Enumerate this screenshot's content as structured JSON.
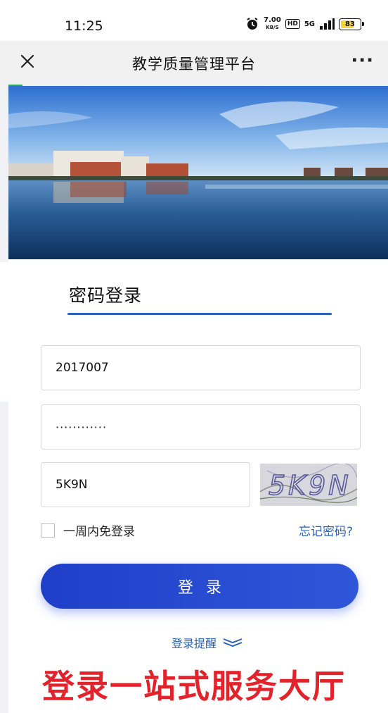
{
  "status_bar": {
    "time": "11:25",
    "net_speed_value": "7.00",
    "net_speed_unit": "KB/S",
    "hd_label": "HD",
    "network_label": "5G",
    "battery_level": "83",
    "battery_fill_percent": 83
  },
  "nav": {
    "title": "教学质量管理平台",
    "more_label": "···"
  },
  "login_tab": {
    "label": "密码登录"
  },
  "form": {
    "username_value": "2017007",
    "password_value": "············",
    "captcha_value": "5K9N",
    "captcha_image_text": "5K9N",
    "remember_label": "一周内免登录",
    "remember_checked": false,
    "forgot_label": "忘记密码?",
    "login_label": "登录"
  },
  "hint": {
    "label": "登录提醒"
  },
  "promo_text": "登录一站式服务大厅",
  "colors": {
    "accent_blue": "#2c63b8",
    "button_blue": "#1f3fc9",
    "promo_red": "#e2232b",
    "nav_bg": "#f1f1f1"
  }
}
